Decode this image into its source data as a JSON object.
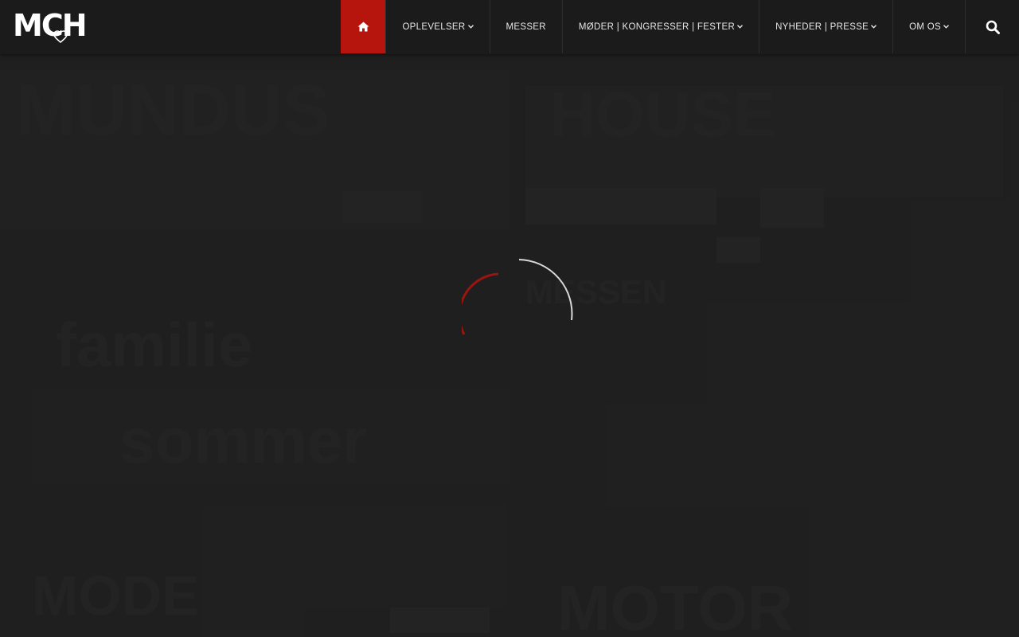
{
  "brand": {
    "logo_text": "MCH",
    "home_color": "#b5150d"
  },
  "nav": {
    "home_icon": "home-icon",
    "items": [
      {
        "label": "OPLEVELSER",
        "has_dropdown": true
      },
      {
        "label": "MESSER",
        "has_dropdown": false
      },
      {
        "label": "MØDER | KONGRESSER | FESTER",
        "has_dropdown": true
      },
      {
        "label": "NYHEDER | PRESSE",
        "has_dropdown": true
      },
      {
        "label": "OM OS",
        "has_dropdown": true
      }
    ],
    "search_icon": "search-icon"
  },
  "loader": {
    "state": "loading",
    "accent_color": "#9b1510",
    "secondary_color": "#d8d8d8"
  }
}
